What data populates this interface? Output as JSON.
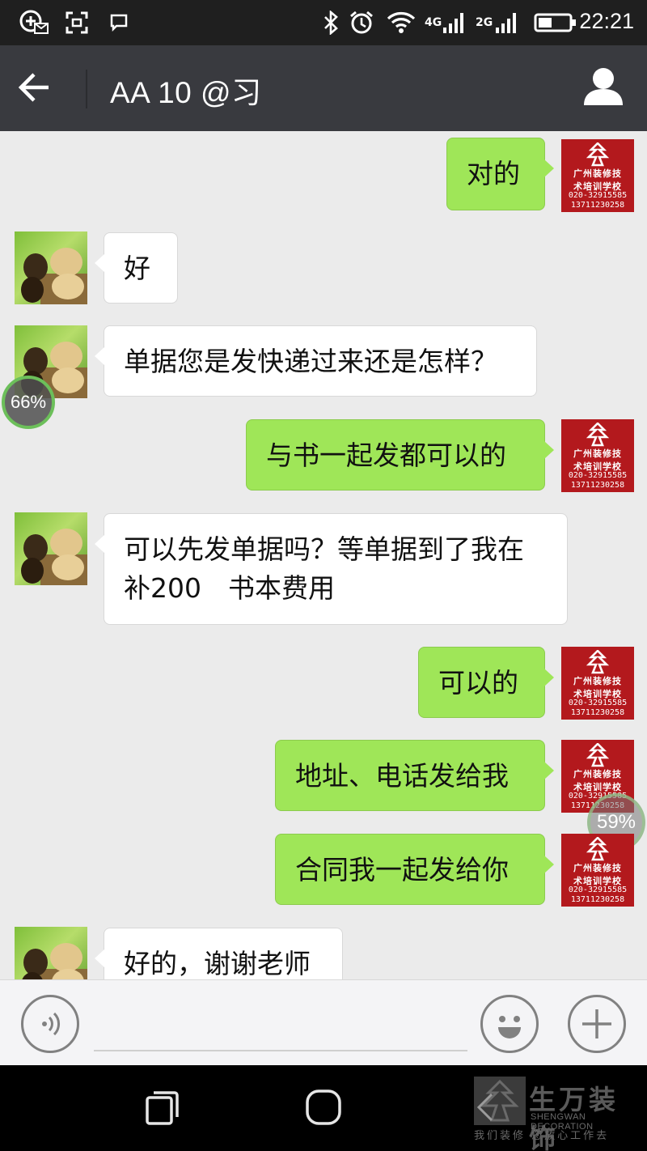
{
  "status_bar": {
    "time": "22:21",
    "network_1": "4G",
    "network_2": "2G",
    "icons": [
      "vpn-mail-icon",
      "screenshot-icon",
      "message-icon",
      "bluetooth-icon",
      "alarm-icon",
      "wifi-icon",
      "signal-icon",
      "signal-icon-2",
      "battery-icon"
    ]
  },
  "header": {
    "title": "AA  10 @习"
  },
  "messages": [
    {
      "side": "right",
      "text": "对的"
    },
    {
      "side": "left",
      "text": "好"
    },
    {
      "side": "left",
      "text": "单据您是发快递过来还是怎样？"
    },
    {
      "side": "right",
      "text": "与书一起发都可以的"
    },
    {
      "side": "left",
      "text": "可以先发单据吗？等单据到了我在补200　书本费用"
    },
    {
      "side": "right",
      "text": "可以的"
    },
    {
      "side": "right",
      "text": "地址、电话发给我"
    },
    {
      "side": "right",
      "text": "合同我一起发给你"
    },
    {
      "side": "left",
      "text": "好的，谢谢老师"
    }
  ],
  "school_avatar": {
    "line1": "广州装修技",
    "line2": "术培训学校",
    "phone1": "020-32915585",
    "phone2": "13711230258",
    "color": "#b3191d"
  },
  "overlays": {
    "badge_left": "66%",
    "badge_right": "59%"
  },
  "input": {
    "placeholder": ""
  },
  "watermark": {
    "title": "生万装饰",
    "subtitle": "SHENGWAN DECORATION",
    "slogan": "我们装修 您放心工作去"
  },
  "colors": {
    "sent_bubble": "#9fe658",
    "received_bubble": "#ffffff",
    "header_bg": "#393a3f",
    "chat_bg": "#ebebeb"
  }
}
